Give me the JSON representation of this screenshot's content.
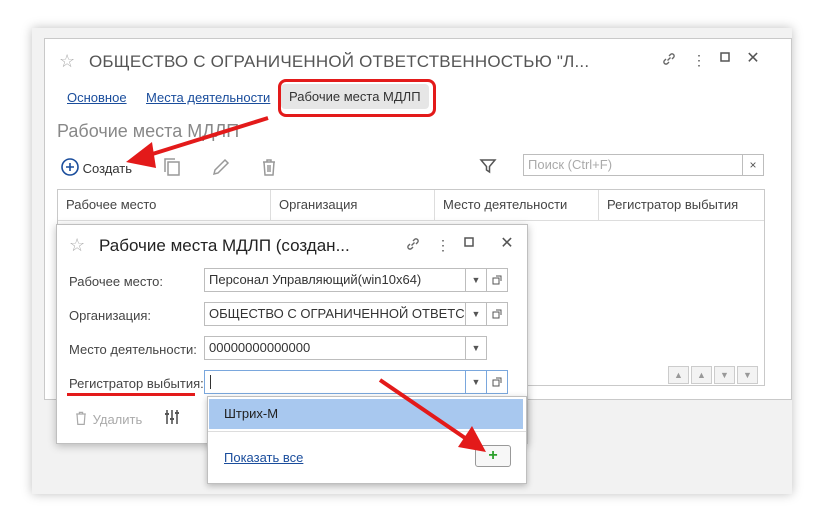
{
  "window": {
    "title": "ОБЩЕСТВО С ОГРАНИЧЕННОЙ ОТВЕТСТВЕННОСТЬЮ \"Л...",
    "tabs": [
      "Основное",
      "Места деятельности"
    ],
    "active_tab": "Рабочие места МДЛП",
    "section_title": "Рабочие места МДЛП",
    "toolbar": {
      "create_label": "Создать"
    },
    "search": {
      "placeholder": "Поиск (Ctrl+F)",
      "clear": "×"
    },
    "table": {
      "columns": [
        "Рабочее место",
        "Организация",
        "Место деятельности",
        "Регистратор выбытия"
      ]
    }
  },
  "dialog": {
    "title": "Рабочие места МДЛП (создан...",
    "fields": [
      {
        "label": "Рабочее место:",
        "value": "Персонал Управляющий(win10x64)"
      },
      {
        "label": "Организация:",
        "value": "ОБЩЕСТВО С ОГРАНИЧЕННОЙ ОТВЕТС"
      },
      {
        "label": "Место деятельности:",
        "value": "00000000000000"
      },
      {
        "label": "Регистратор выбытия:",
        "value": ""
      }
    ],
    "footer": {
      "delete_label": "Удалить"
    }
  },
  "dropdown": {
    "items": [
      "Штрих-М"
    ],
    "show_all_label": "Показать все",
    "add_label": "+"
  },
  "colors": {
    "accent": "#1a4d9c",
    "highlight": "#e31a1a",
    "selection": "#a8c8ef",
    "add": "#2ca02c"
  }
}
